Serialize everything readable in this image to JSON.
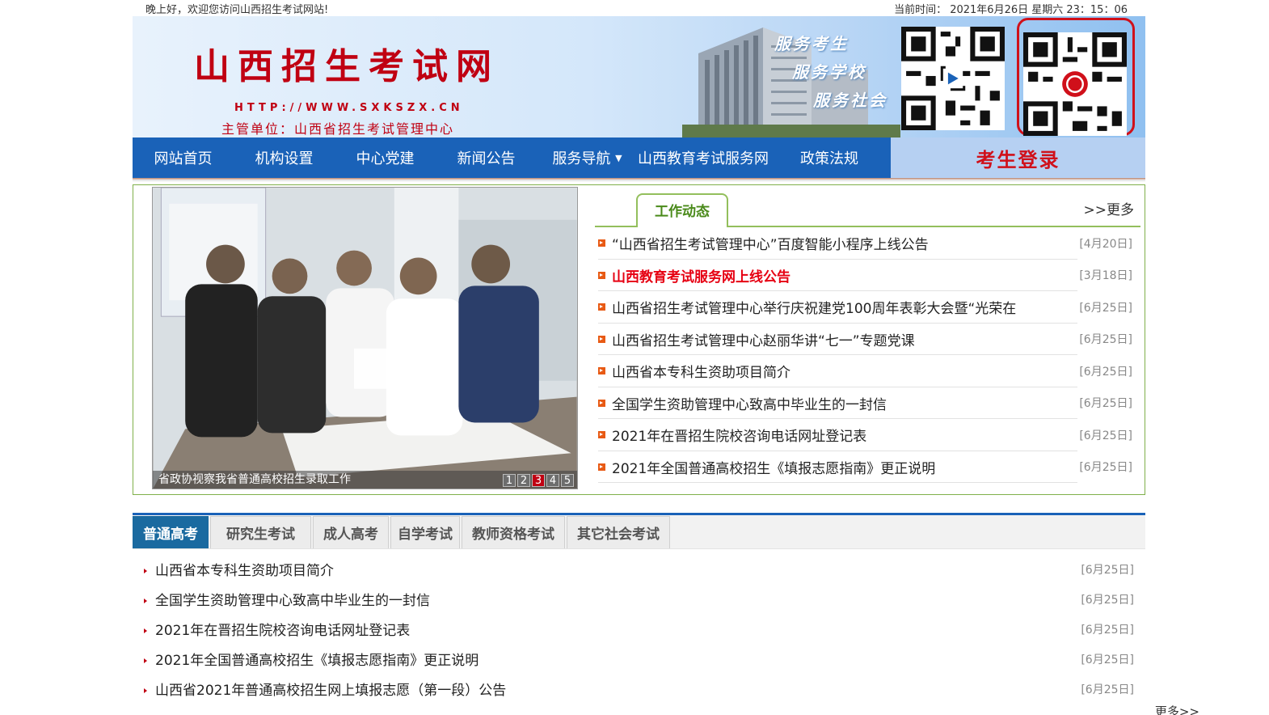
{
  "topbar": {
    "greeting": "晚上好，欢迎您访问山西招生考试网站!",
    "time": "当前时间： 2021年6月26日 星期六 23：15：06"
  },
  "header": {
    "site_title": "山西招生考试网",
    "url": "HTTP://WWW.SXKSZX.CN",
    "supervisor": "主管单位：山西省招生考试管理中心",
    "slogans": [
      "服务考生",
      "服务学校",
      "服务社会"
    ],
    "qr_codes": [
      "qr-code-icon",
      "qr-code-icon"
    ]
  },
  "nav": {
    "items": [
      "网站首页",
      "机构设置",
      "中心党建",
      "新闻公告",
      "服务导航",
      "山西教育考试服务网",
      "政策法规"
    ],
    "login": "考生登录",
    "accent": "#1a62b8"
  },
  "slideshow": {
    "caption": "省政协视察我省普通高校招生录取工作",
    "pages": [
      "1",
      "2",
      "3",
      "4",
      "5"
    ],
    "active_page": "3"
  },
  "news": {
    "tab": "工作动态",
    "more": ">>更多",
    "items": [
      {
        "title": "“山西省招生考试管理中心”百度智能小程序上线公告",
        "date": "[4月20日]"
      },
      {
        "title": "山西教育考试服务网上线公告",
        "date": "[3月18日]"
      },
      {
        "title": "山西省招生考试管理中心举行庆祝建党100周年表彰大会暨“光荣在",
        "date": "[6月25日]"
      },
      {
        "title": "山西省招生考试管理中心赵丽华讲“七一”专题党课",
        "date": "[6月25日]"
      },
      {
        "title": "山西省本专科生资助项目简介",
        "date": "[6月25日]"
      },
      {
        "title": "全国学生资助管理中心致高中毕业生的一封信",
        "date": "[6月25日]"
      },
      {
        "title": "2021年在晋招生院校咨询电话网址登记表",
        "date": "[6月25日]"
      },
      {
        "title": "2021年全国普通高校招生《填报志愿指南》更正说明",
        "date": "[6月25日]"
      }
    ]
  },
  "exams": {
    "tabs": [
      "普通高考",
      "研究生考试",
      "成人高考",
      "自学考试",
      "教师资格考试",
      "其它社会考试"
    ],
    "items": [
      {
        "title": "山西省本专科生资助项目简介",
        "date": "[6月25日]"
      },
      {
        "title": "全国学生资助管理中心致高中毕业生的一封信",
        "date": "[6月25日]"
      },
      {
        "title": "2021年在晋招生院校咨询电话网址登记表",
        "date": "[6月25日]"
      },
      {
        "title": "2021年全国普通高校招生《填报志愿指南》更正说明",
        "date": "[6月25日]"
      },
      {
        "title": "山西省2021年普通高校招生网上填报志愿（第一段）公告",
        "date": "[6月25日]"
      }
    ],
    "more": "更多>>"
  }
}
